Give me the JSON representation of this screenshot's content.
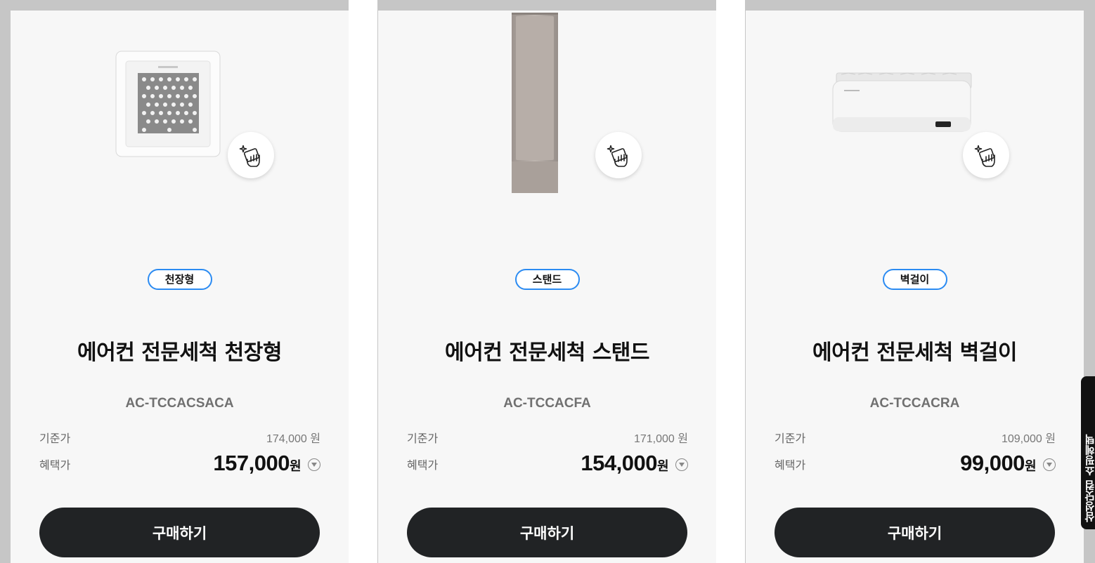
{
  "products": [
    {
      "type_tag": "천장형",
      "title": "에어컨 전문세척 천장형",
      "model": "AC-TCCACSACA",
      "base_price_label": "기준가",
      "base_price": "174,000 원",
      "benefit_price_label": "혜택가",
      "benefit_price": "157,000",
      "benefit_currency": "원",
      "buy_label": "구매하기"
    },
    {
      "type_tag": "스탠드",
      "title": "에어컨 전문세척 스탠드",
      "model": "AC-TCCACFA",
      "base_price_label": "기준가",
      "base_price": "171,000 원",
      "benefit_price_label": "혜택가",
      "benefit_price": "154,000",
      "benefit_currency": "원",
      "buy_label": "구매하기"
    },
    {
      "type_tag": "벽걸이",
      "title": "에어컨 전문세척 벽걸이",
      "model": "AC-TCCACRA",
      "base_price_label": "기준가",
      "base_price": "109,000 원",
      "benefit_price_label": "혜택가",
      "benefit_price": "99,000",
      "benefit_currency": "원",
      "buy_label": "구매하기"
    }
  ],
  "side_tab": {
    "label": "삼성닷컴 쇼핑혜택"
  },
  "colors": {
    "accent_border": "#2b8bf2",
    "button_bg": "#212325",
    "card_bg": "#f7f7f7",
    "page_bg": "#c6c6c6"
  },
  "icons": {
    "clean_badge": "cleaning-hand-sparkle-icon",
    "price_toggle": "chevron-down-circle-icon"
  }
}
